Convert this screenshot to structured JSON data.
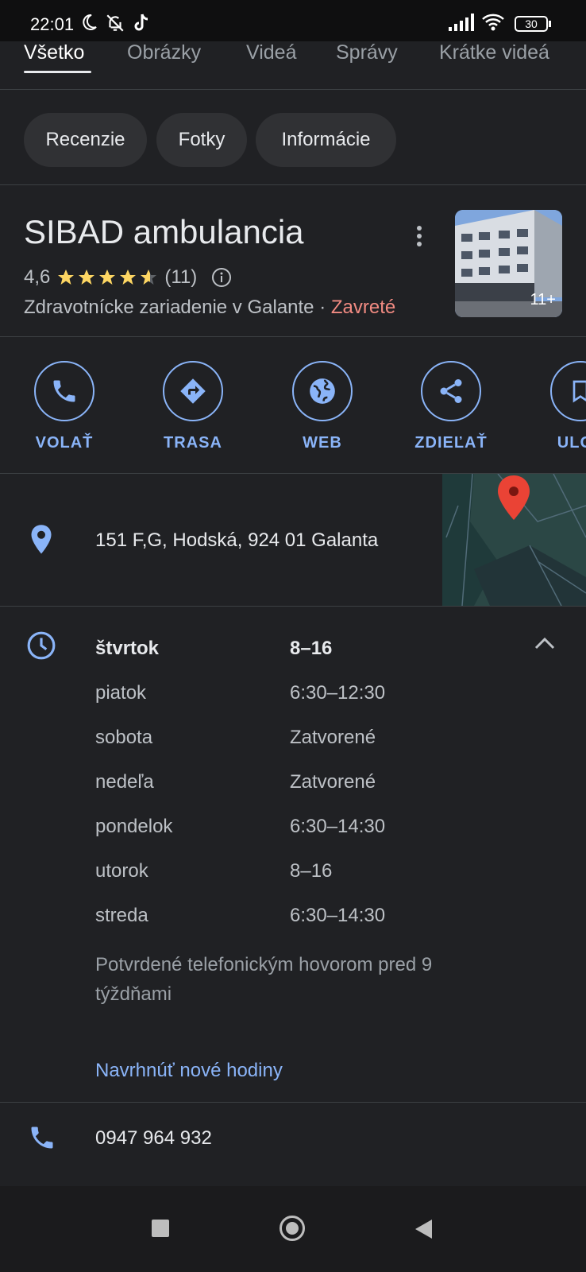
{
  "status_bar": {
    "time": "22:01",
    "battery": "30",
    "icons": [
      "moon-icon",
      "bell-off-icon",
      "tiktok-icon",
      "signal-icon",
      "wifi-icon",
      "battery-icon"
    ]
  },
  "tabs": [
    {
      "label": "Všetko",
      "active": true
    },
    {
      "label": "Obrázky"
    },
    {
      "label": "Videá"
    },
    {
      "label": "Správy"
    },
    {
      "label": "Krátke videá"
    }
  ],
  "chips": [
    "Recenzie",
    "Fotky",
    "Informácie"
  ],
  "place": {
    "name": "SIBAD ambulancia",
    "rating": "4,6",
    "rating_value": 4.6,
    "review_count": "(11)",
    "category": "Zdravotnícke zariadenie v Galante",
    "separator": "·",
    "status": "Zavreté",
    "photo_count": "11+"
  },
  "actions": [
    {
      "label": "VOLAŤ",
      "icon": "phone-icon"
    },
    {
      "label": "TRASA",
      "icon": "directions-icon"
    },
    {
      "label": "WEB",
      "icon": "globe-icon"
    },
    {
      "label": "ZDIEĽAŤ",
      "icon": "share-icon"
    },
    {
      "label": "ULOŽ",
      "icon": "bookmark-icon"
    }
  ],
  "address": "151 F,G, Hodská, 924 01 Galanta",
  "hours": [
    {
      "day": "štvrtok",
      "time": "8–16",
      "today": true
    },
    {
      "day": "piatok",
      "time": "6:30–12:30"
    },
    {
      "day": "sobota",
      "time": "Zatvorené"
    },
    {
      "day": "nedeľa",
      "time": "Zatvorené"
    },
    {
      "day": "pondelok",
      "time": "6:30–14:30"
    },
    {
      "day": "utorok",
      "time": "8–16"
    },
    {
      "day": "streda",
      "time": "6:30–14:30"
    }
  ],
  "hours_confirmation": "Potvrdené telefonickým hovorom pred 9 týždňami",
  "suggest_hours": "Navrhnúť nové hodiny",
  "phone": "0947 964 932",
  "colors": {
    "background": "#202124",
    "accent": "#8ab4f8",
    "star": "#fdd663",
    "closed": "#f28b82",
    "pin": "#ea4335"
  }
}
